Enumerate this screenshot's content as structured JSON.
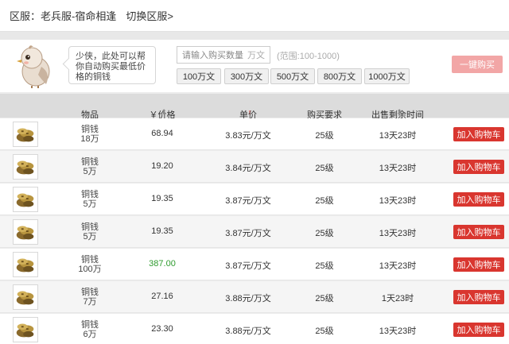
{
  "server": {
    "label": "区服：老兵服-宿命相逢",
    "switch": "切换区服>"
  },
  "quick": {
    "bubble": "少侠，此处可以帮你自动购买最低价格的铜钱",
    "qty_placeholder": "请输入购买数量",
    "qty_unit": "万文",
    "range": "(范围:100-1000)",
    "amounts": [
      "100万文",
      "300万文",
      "500万文",
      "800万文",
      "1000万文"
    ],
    "buy": "一键购买"
  },
  "table": {
    "headers": {
      "item": "物品",
      "price": "￥价格",
      "unit_price": "单价",
      "level": "购买要求",
      "time": "出售剩余时间"
    },
    "rows": [
      {
        "item": "铜钱",
        "qty": "18万",
        "price": "68.94",
        "unit": "3.83元/万文",
        "level": "25级",
        "time": "13天23时",
        "price_color": "normal"
      },
      {
        "item": "铜钱",
        "qty": "5万",
        "price": "19.20",
        "unit": "3.84元/万文",
        "level": "25级",
        "time": "13天23时",
        "price_color": "normal"
      },
      {
        "item": "铜钱",
        "qty": "5万",
        "price": "19.35",
        "unit": "3.87元/万文",
        "level": "25级",
        "time": "13天23时",
        "price_color": "normal"
      },
      {
        "item": "铜钱",
        "qty": "5万",
        "price": "19.35",
        "unit": "3.87元/万文",
        "level": "25级",
        "time": "13天23时",
        "price_color": "normal"
      },
      {
        "item": "铜钱",
        "qty": "100万",
        "price": "387.00",
        "unit": "3.87元/万文",
        "level": "25级",
        "time": "13天23时",
        "price_color": "green"
      },
      {
        "item": "铜钱",
        "qty": "7万",
        "price": "27.16",
        "unit": "3.88元/万文",
        "level": "25级",
        "time": "1天23时",
        "price_color": "normal"
      },
      {
        "item": "铜钱",
        "qty": "6万",
        "price": "23.30",
        "unit": "3.88元/万文",
        "level": "25级",
        "time": "13天23时",
        "price_color": "normal"
      }
    ],
    "cart": "加入购物车"
  },
  "colors": {
    "accent": "#d9362f",
    "buy_disabled": "#f2a6a6",
    "green_price": "#2e9b2e"
  },
  "icons": {
    "item": "copper-coins-icon",
    "mascot": "owl-mascot-icon"
  }
}
